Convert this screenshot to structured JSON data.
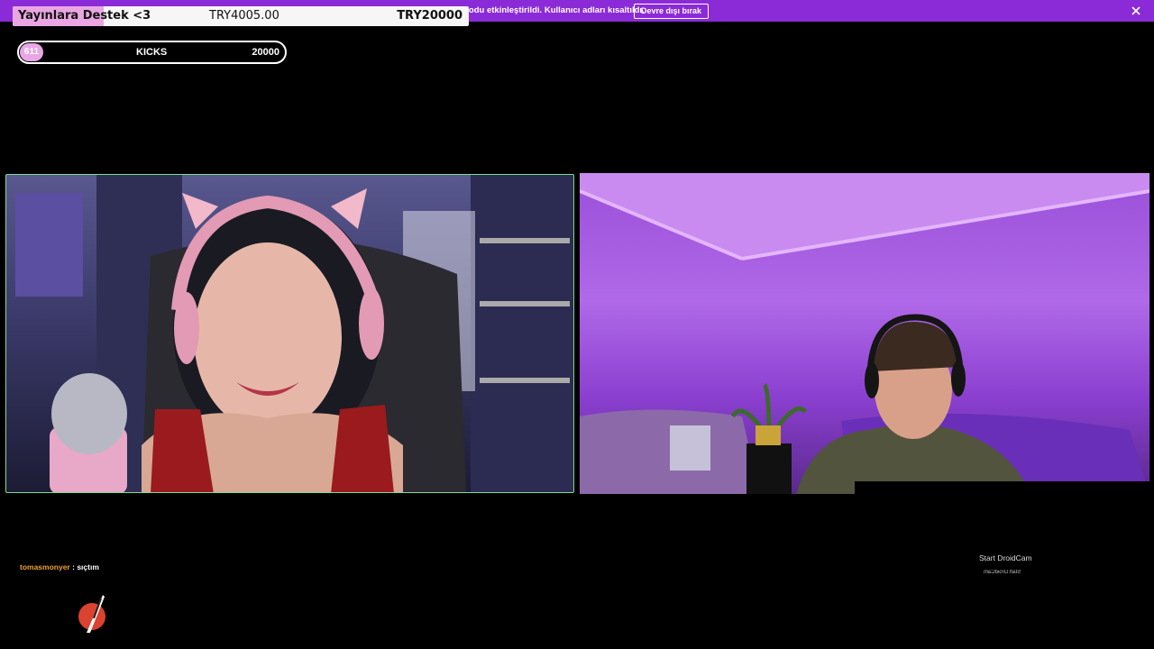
{
  "notice": {
    "text": "Modu etkinleştirildi. Kullanıcı adları kısaltıldı.",
    "button_label": "Devre dışı bırak"
  },
  "goal": {
    "title": "Yayınlara Destek <3",
    "current": "TRY4005.00",
    "target": "TRY20000",
    "progress_fraction": 0.2
  },
  "kicks": {
    "count": "611",
    "label": "KICKS",
    "target": "20000"
  },
  "chat": {
    "user": "tomasmonyer",
    "separator": " : ",
    "message": "sıçtım"
  },
  "droidcam": {
    "label": "Start DroidCam",
    "mirrored_label": "Start DroidCam"
  },
  "colors": {
    "notice_bg": "#8b2bd8",
    "goal_fill": "#e9a6e3",
    "chat_user": "#f0a12c",
    "cam_border": "#7fdc8f"
  }
}
